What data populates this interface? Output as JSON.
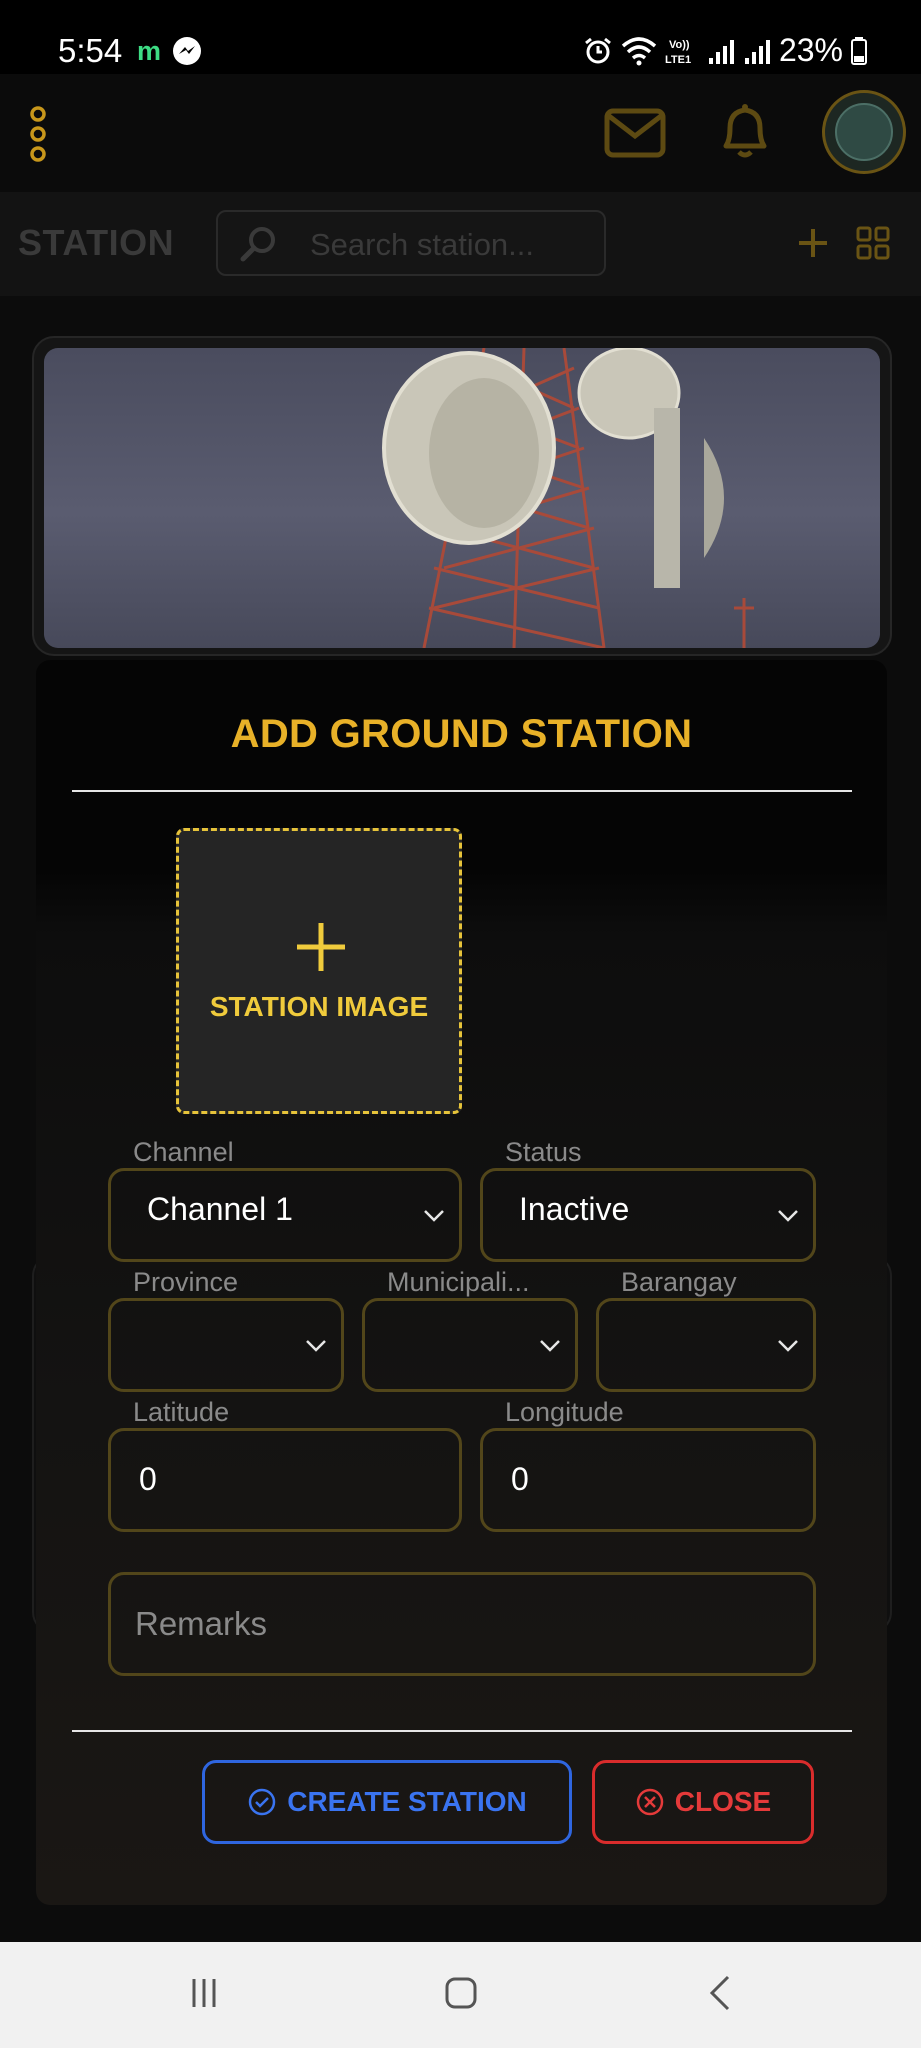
{
  "status_bar": {
    "time": "5:54",
    "notif_app_letter": "m",
    "battery_percent": "23%"
  },
  "header": {
    "page_title": "STATION",
    "search_placeholder": "Search station..."
  },
  "modal": {
    "title": "ADD GROUND STATION",
    "image_label": "STATION IMAGE",
    "fields": {
      "channel": {
        "label": "Channel",
        "value": "Channel 1"
      },
      "status": {
        "label": "Status",
        "value": "Inactive"
      },
      "province": {
        "label": "Province",
        "value": ""
      },
      "municipality": {
        "label": "Municipali...",
        "value": ""
      },
      "barangay": {
        "label": "Barangay",
        "value": ""
      },
      "latitude": {
        "label": "Latitude",
        "value": "0"
      },
      "longitude": {
        "label": "Longitude",
        "value": "0"
      },
      "remarks": {
        "placeholder": "Remarks"
      }
    },
    "buttons": {
      "create": "CREATE STATION",
      "close": "CLOSE"
    }
  },
  "colors": {
    "accent": "#e8b128",
    "field_border": "#52461a",
    "create_blue": "#2f66e0",
    "close_red": "#d92c2c"
  }
}
